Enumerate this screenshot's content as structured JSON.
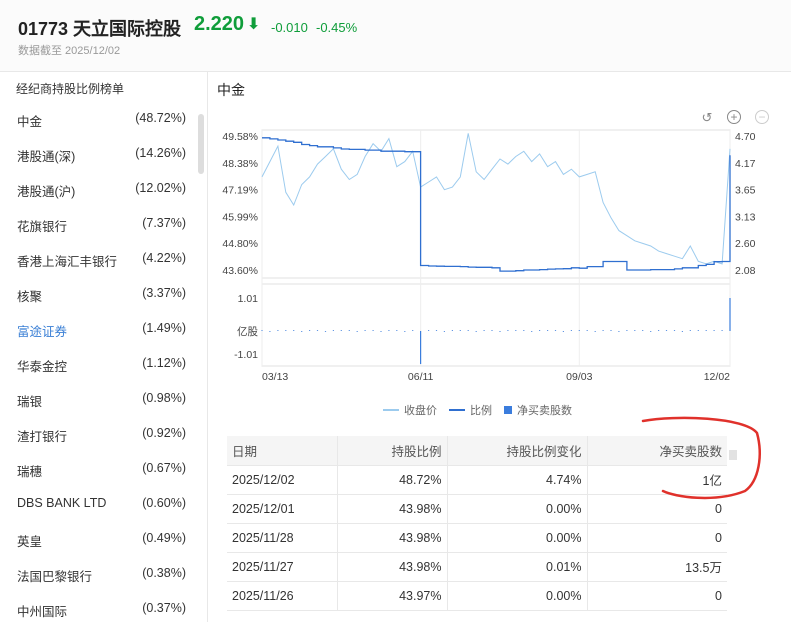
{
  "header": {
    "stock_title": "01773 天立国际控股",
    "price": "2.220",
    "change": "-0.010",
    "change_pct": "-0.45%",
    "data_date": "数据截至 2025/12/02",
    "color_down": "#0f9d3a"
  },
  "sidebar": {
    "title": "经纪商持股比例榜单",
    "items": [
      {
        "name": "中金",
        "pct": "(48.72%)"
      },
      {
        "name": "港股通(深)",
        "pct": "(14.26%)"
      },
      {
        "name": "港股通(沪)",
        "pct": "(12.02%)"
      },
      {
        "name": "花旗银行",
        "pct": "(7.37%)"
      },
      {
        "name": "香港上海汇丰银行",
        "pct": "(4.22%)"
      },
      {
        "name": "核聚",
        "pct": "(3.37%)"
      },
      {
        "name": "富途证券",
        "pct": "(1.49%)"
      },
      {
        "name": "华泰金控",
        "pct": "(1.12%)"
      },
      {
        "name": "瑞银",
        "pct": "(0.98%)"
      },
      {
        "name": "渣打银行",
        "pct": "(0.92%)"
      },
      {
        "name": "瑞穗",
        "pct": "(0.67%)"
      },
      {
        "name": "DBS BANK LTD",
        "pct": "(0.60%)"
      },
      {
        "name": "英皇",
        "pct": "(0.49%)"
      },
      {
        "name": "法国巴黎银行",
        "pct": "(0.38%)"
      },
      {
        "name": "中州国际",
        "pct": "(0.37%)"
      }
    ]
  },
  "main": {
    "title": "中金",
    "icons": [
      "reset-icon",
      "zoom-in-icon",
      "zoom-out-icon"
    ]
  },
  "chart_data": {
    "type": "line",
    "x_ticks": [
      "03/13",
      "06/11",
      "09/03",
      "12/02"
    ],
    "left_axis_ticks": [
      "49.58%",
      "48.38%",
      "47.19%",
      "45.99%",
      "44.80%",
      "43.60%"
    ],
    "right_axis_ticks": [
      "4.70",
      "4.17",
      "3.65",
      "3.13",
      "2.60",
      "2.08"
    ],
    "sub_axis_ticks": [
      "1.01",
      "亿股",
      "-1.01"
    ],
    "ylim_left": [
      43.6,
      49.58
    ],
    "ylim_right": [
      2.08,
      4.7
    ],
    "ylim_sub": [
      -1.01,
      1.01
    ],
    "series": [
      {
        "name": "收盘价",
        "axis": "right",
        "color": "#9ccbee",
        "values": [
          3.9,
          4.2,
          4.5,
          3.6,
          3.35,
          3.75,
          3.9,
          4.15,
          4.3,
          4.45,
          4.05,
          3.85,
          3.95,
          4.3,
          4.55,
          4.4,
          4.65,
          4.1,
          4.2,
          4.4,
          3.7,
          3.8,
          3.9,
          3.65,
          3.7,
          3.9,
          4.75,
          4.0,
          3.85,
          4.05,
          4.25,
          4.15,
          4.3,
          4.4,
          4.2,
          4.35,
          4.1,
          4.2,
          3.95,
          4.05,
          3.9,
          3.95,
          4.0,
          3.4,
          3.1,
          2.85,
          2.75,
          2.65,
          2.6,
          2.55,
          2.45,
          2.4,
          2.35,
          2.3,
          2.55,
          2.25,
          2.2,
          2.25,
          2.2,
          4.45
        ]
      },
      {
        "name": "比例",
        "axis": "left",
        "color": "#2f6fd0",
        "values": [
          49.5,
          49.45,
          49.4,
          49.35,
          49.3,
          49.2,
          49.15,
          49.1,
          49.1,
          49.05,
          49.0,
          48.98,
          48.98,
          48.95,
          48.95,
          48.9,
          48.9,
          48.9,
          48.88,
          48.88,
          43.8,
          43.78,
          43.77,
          43.76,
          43.76,
          43.75,
          43.73,
          43.72,
          43.72,
          43.7,
          43.55,
          43.55,
          43.57,
          43.6,
          43.6,
          43.62,
          43.64,
          43.65,
          43.66,
          43.7,
          43.68,
          43.75,
          43.75,
          43.98,
          43.98,
          43.98,
          43.6,
          43.6,
          43.6,
          43.62,
          43.62,
          43.62,
          43.65,
          43.7,
          43.7,
          43.8,
          43.85,
          43.97,
          43.98,
          48.72
        ]
      },
      {
        "name": "净买卖股数",
        "axis": "sub",
        "color": "#3b7ddd",
        "values": [
          0.01,
          -0.01,
          0.01,
          0.0,
          0.01,
          -0.01,
          0.01,
          0.0,
          -0.01,
          0.01,
          0.0,
          0.01,
          -0.01,
          0.0,
          0.01,
          -0.01,
          0.0,
          0.01,
          -0.01,
          0.0,
          -1.01,
          0.01,
          0.0,
          -0.01,
          0.01,
          0.0,
          0.01,
          -0.01,
          0.0,
          0.01,
          -0.01,
          0.0,
          0.01,
          0.0,
          -0.01,
          0.01,
          0.0,
          0.01,
          -0.01,
          0.0,
          0.01,
          0.0,
          -0.01,
          0.01,
          0.0,
          -0.01,
          0.01,
          0.0,
          0.01,
          -0.01,
          0.0,
          0.01,
          0.0,
          -0.01,
          0.01,
          0.0,
          0.01,
          0.0,
          0.0,
          1.01
        ]
      }
    ],
    "legend_position": "bottom"
  },
  "table": {
    "headers": [
      "日期",
      "持股比例",
      "持股比例变化",
      "净买卖股数"
    ],
    "rows": [
      [
        "2025/12/02",
        "48.72%",
        "4.74%",
        "1亿"
      ],
      [
        "2025/12/01",
        "43.98%",
        "0.00%",
        "0"
      ],
      [
        "2025/11/28",
        "43.98%",
        "0.00%",
        "0"
      ],
      [
        "2025/11/27",
        "43.98%",
        "0.01%",
        "13.5万"
      ],
      [
        "2025/11/26",
        "43.97%",
        "0.00%",
        "0"
      ]
    ]
  },
  "colors": {
    "accent": "#3a7fd5",
    "down": "#0f9d3a",
    "annotation": "#e0312b"
  }
}
